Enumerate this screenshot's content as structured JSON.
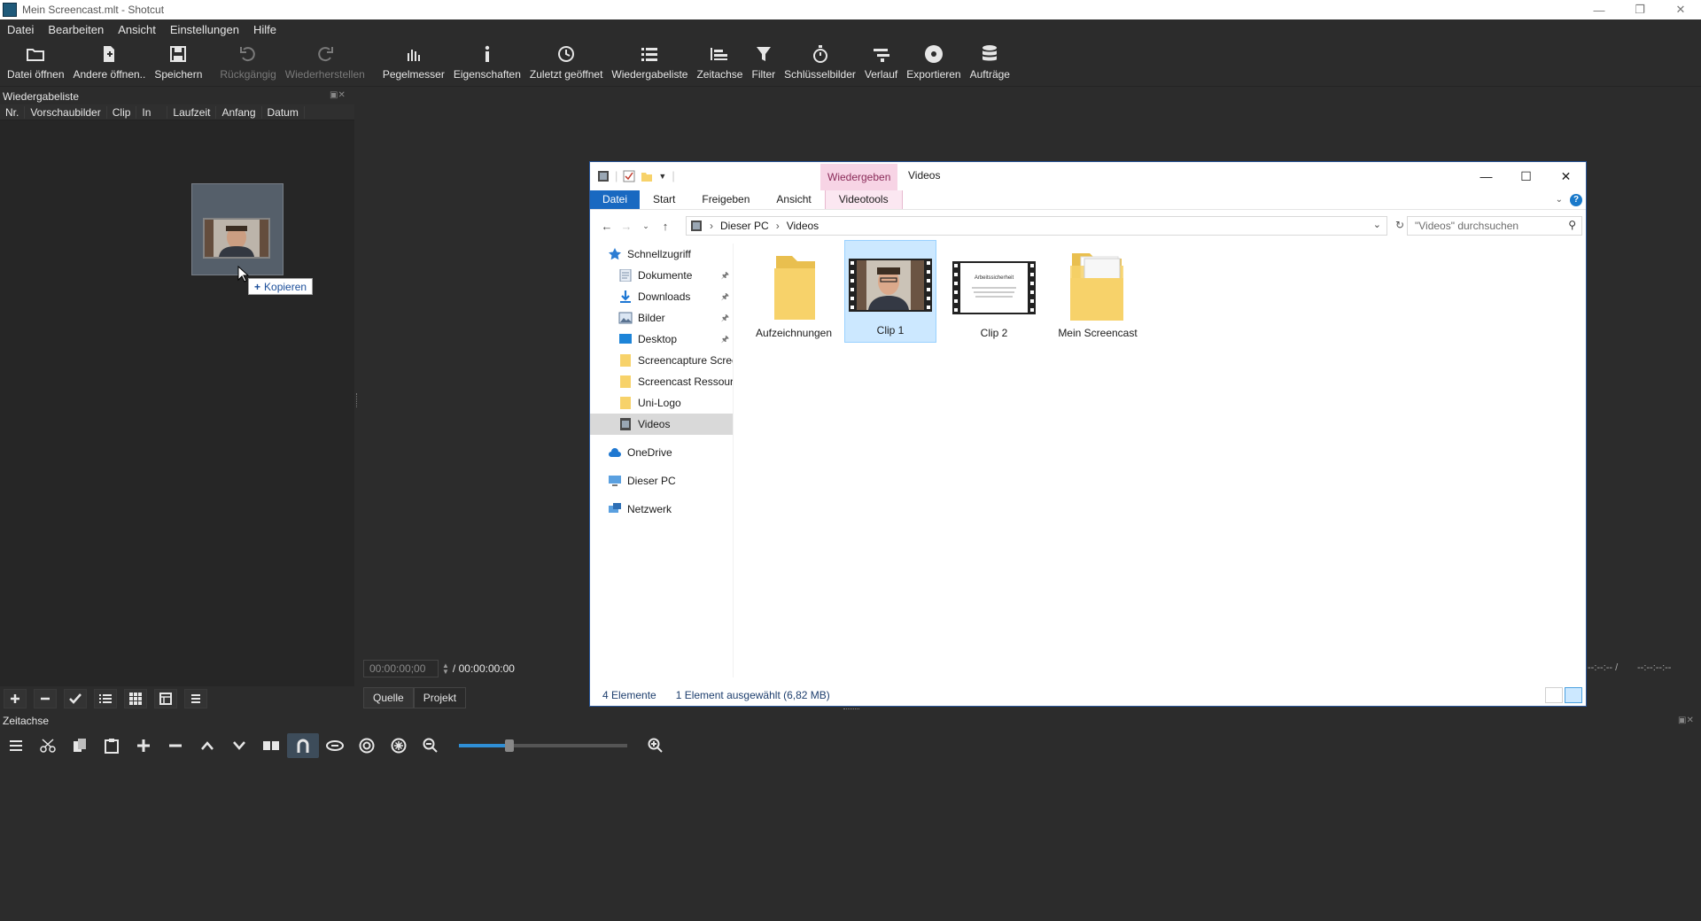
{
  "app": {
    "title": "Mein Screencast.mlt - Shotcut",
    "menu": [
      "Datei",
      "Bearbeiten",
      "Ansicht",
      "Einstellungen",
      "Hilfe"
    ],
    "toolbar": [
      {
        "label": "Datei öffnen",
        "icon": "folder-open-icon",
        "enabled": true
      },
      {
        "label": "Andere öffnen..",
        "icon": "open-other-icon",
        "enabled": true
      },
      {
        "label": "Speichern",
        "icon": "save-icon",
        "enabled": true
      },
      {
        "label": "Rückgängig",
        "icon": "undo-icon",
        "enabled": false
      },
      {
        "label": "Wiederherstellen",
        "icon": "redo-icon",
        "enabled": false
      },
      {
        "label": "Pegelmesser",
        "icon": "audio-meter-icon",
        "enabled": true
      },
      {
        "label": "Eigenschaften",
        "icon": "properties-icon",
        "enabled": true
      },
      {
        "label": "Zuletzt geöffnet",
        "icon": "recent-icon",
        "enabled": true
      },
      {
        "label": "Wiedergabeliste",
        "icon": "playlist-icon",
        "enabled": true
      },
      {
        "label": "Zeitachse",
        "icon": "timeline-icon",
        "enabled": true
      },
      {
        "label": "Filter",
        "icon": "filter-icon",
        "enabled": true
      },
      {
        "label": "Schlüsselbilder",
        "icon": "keyframes-icon",
        "enabled": true
      },
      {
        "label": "Verlauf",
        "icon": "history-icon",
        "enabled": true
      },
      {
        "label": "Exportieren",
        "icon": "export-icon",
        "enabled": true
      },
      {
        "label": "Aufträge",
        "icon": "jobs-icon",
        "enabled": true
      }
    ]
  },
  "playlist": {
    "title": "Wiedergabeliste",
    "columns": [
      "Nr.",
      "Vorschaubilder",
      "Clip",
      "In",
      "Laufzeit",
      "Anfang",
      "Datum"
    ],
    "drag_tooltip": "Kopieren",
    "bottom_buttons": [
      "add-icon",
      "remove-icon",
      "check-icon",
      "list-view-icon",
      "grid-view-icon",
      "detail-view-icon",
      "menu-icon"
    ]
  },
  "player": {
    "timecode_current": "00:00:00;00",
    "timecode_total": "/ 00:00:00:00",
    "tabs": [
      "Quelle",
      "Projekt"
    ],
    "right_tc_a": "--:--:-- /",
    "right_tc_b": "--:--:--:--"
  },
  "timeline": {
    "title": "Zeitachse",
    "tools": [
      "menu-icon",
      "cut-icon",
      "copy-icon",
      "paste-icon",
      "append-icon",
      "remove-icon",
      "lift-icon",
      "overwrite-icon",
      "split-icon",
      "snap-icon",
      "scrub-icon",
      "ripple-icon",
      "ripple-all-icon",
      "zoom-out-icon",
      "zoom-in-icon"
    ],
    "zoom_level": 0.3
  },
  "explorer": {
    "window_title": "Videos",
    "context_tab": "Wiedergeben",
    "ribbon_tabs": [
      "Datei",
      "Start",
      "Freigeben",
      "Ansicht",
      "Videotools"
    ],
    "breadcrumb": [
      "Dieser PC",
      "Videos"
    ],
    "search_placeholder": "\"Videos\" durchsuchen",
    "nav": [
      {
        "label": "Schnellzugriff",
        "icon": "star-icon",
        "indent": 0,
        "pinned": false,
        "selected": false
      },
      {
        "label": "Dokumente",
        "icon": "documents-icon",
        "indent": 1,
        "pinned": true,
        "selected": false
      },
      {
        "label": "Downloads",
        "icon": "downloads-icon",
        "indent": 1,
        "pinned": true,
        "selected": false
      },
      {
        "label": "Bilder",
        "icon": "pictures-icon",
        "indent": 1,
        "pinned": true,
        "selected": false
      },
      {
        "label": "Desktop",
        "icon": "desktop-icon",
        "indent": 1,
        "pinned": true,
        "selected": false
      },
      {
        "label": "Screencapture Scree",
        "icon": "folder-icon",
        "indent": 1,
        "pinned": false,
        "selected": false
      },
      {
        "label": "Screencast Ressourc",
        "icon": "folder-icon",
        "indent": 1,
        "pinned": false,
        "selected": false
      },
      {
        "label": "Uni-Logo",
        "icon": "folder-icon",
        "indent": 1,
        "pinned": false,
        "selected": false
      },
      {
        "label": "Videos",
        "icon": "videos-icon",
        "indent": 1,
        "pinned": false,
        "selected": true
      },
      {
        "label": "OneDrive",
        "icon": "cloud-icon",
        "indent": 0,
        "pinned": false,
        "selected": false
      },
      {
        "label": "Dieser PC",
        "icon": "computer-icon",
        "indent": 0,
        "pinned": false,
        "selected": false
      },
      {
        "label": "Netzwerk",
        "icon": "network-icon",
        "indent": 0,
        "pinned": false,
        "selected": false
      }
    ],
    "files": [
      {
        "name": "Aufzeichnungen",
        "type": "folder",
        "selected": false
      },
      {
        "name": "Clip 1",
        "type": "video",
        "selected": true
      },
      {
        "name": "Clip 2",
        "type": "video-doc",
        "selected": false
      },
      {
        "name": "Mein Screencast",
        "type": "folder-doc",
        "selected": false
      }
    ],
    "clip2_thumb_text": "Arbeitssicherheit",
    "status_count": "4 Elemente",
    "status_selection": "1 Element ausgewählt (6,82 MB)",
    "colors": {
      "selection": "#cce8ff",
      "accent": "#1969c1",
      "context": "#f7d4e5",
      "folder": "#f7d26a"
    }
  }
}
